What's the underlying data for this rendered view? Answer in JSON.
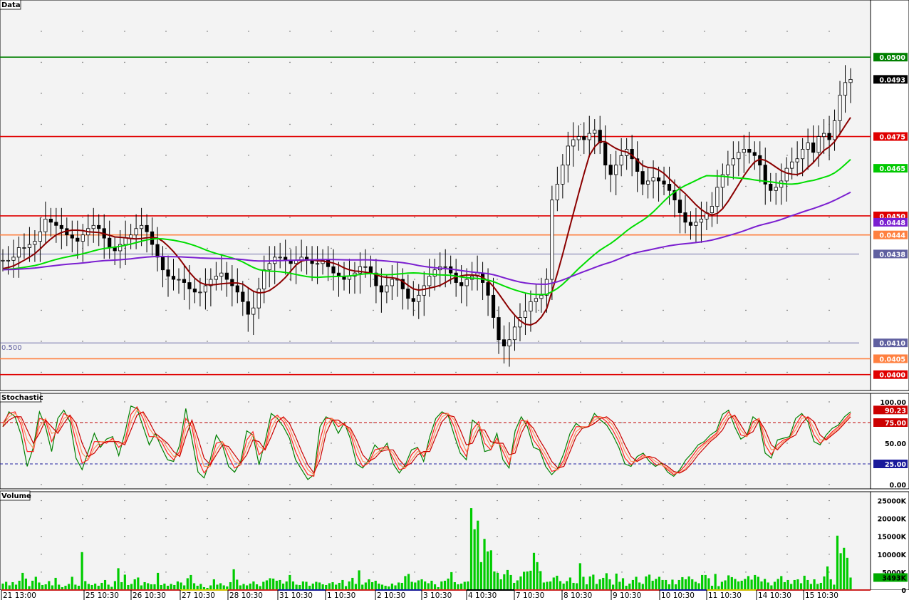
{
  "panels": {
    "price": {
      "title": "Data"
    },
    "stochastic": {
      "title": "Stochastic"
    },
    "volume": {
      "title": "Volume"
    }
  },
  "chart_data": [
    {
      "type": "candlestick",
      "title": "Data",
      "ylim": [
        0.0395,
        0.0518
      ],
      "grid": true,
      "overlay_label": "0.500",
      "horizontal_lines": [
        {
          "value": 0.05,
          "label": "0.0500",
          "color": "#008000"
        },
        {
          "value": 0.0475,
          "label": "0.0475",
          "color": "#e00000"
        },
        {
          "value": 0.045,
          "label": "0.0450",
          "color": "#e00000"
        },
        {
          "value": 0.0444,
          "label": "0.0444",
          "color": "#ff8040"
        },
        {
          "value": 0.0438,
          "label": "0.0438",
          "color": "#6060a0"
        },
        {
          "value": 0.041,
          "label": "0.0410",
          "color": "#6060a0"
        },
        {
          "value": 0.0405,
          "label": "0.0405",
          "color": "#ff8040"
        },
        {
          "value": 0.04,
          "label": "0.0400",
          "color": "#e00000"
        }
      ],
      "price_tags": [
        {
          "value": 0.0493,
          "label": "0.0493",
          "bg": "#000000",
          "fg": "#ffffff"
        },
        {
          "value": 0.0465,
          "label": "0.0465",
          "bg": "#00c800",
          "fg": "#ffffff"
        },
        {
          "value": 0.0448,
          "label": "0.0448",
          "bg": "#7b1fd0",
          "fg": "#ffffff"
        }
      ],
      "x_ticks": [
        "21 13:00",
        "25 10:30",
        "26 10:30",
        "27 10:30",
        "28 10:30",
        "31 10:30",
        "1 10:30",
        "2 10:30",
        "3 10:30",
        "4 10:30",
        "7 10:30",
        "8 10:30",
        "9 10:30",
        "10 10:30",
        "11 10:30",
        "14 10:30",
        "15 10:30"
      ],
      "close_series": [
        0.0436,
        0.0436,
        0.0437,
        0.044,
        0.044,
        0.0441,
        0.0442,
        0.0445,
        0.0449,
        0.0448,
        0.0447,
        0.0446,
        0.0444,
        0.0443,
        0.0442,
        0.0444,
        0.0446,
        0.0447,
        0.0446,
        0.0443,
        0.044,
        0.0439,
        0.0441,
        0.0443,
        0.0444,
        0.0446,
        0.0447,
        0.0445,
        0.0441,
        0.0437,
        0.0433,
        0.0431,
        0.043,
        0.043,
        0.0429,
        0.0427,
        0.0426,
        0.0426,
        0.0428,
        0.043,
        0.0431,
        0.0432,
        0.043,
        0.0428,
        0.0426,
        0.0423,
        0.0419,
        0.0421,
        0.0427,
        0.0433,
        0.0435,
        0.0437,
        0.0437,
        0.0436,
        0.0435,
        0.0436,
        0.0437,
        0.0436,
        0.0435,
        0.0435,
        0.0436,
        0.0434,
        0.0432,
        0.0431,
        0.043,
        0.0431,
        0.0432,
        0.0434,
        0.0434,
        0.0432,
        0.0428,
        0.0426,
        0.0428,
        0.043,
        0.043,
        0.0427,
        0.0424,
        0.0423,
        0.0425,
        0.0428,
        0.0431,
        0.0433,
        0.0434,
        0.0434,
        0.0432,
        0.0429,
        0.0428,
        0.043,
        0.0431,
        0.0432,
        0.0429,
        0.0425,
        0.0418,
        0.0411,
        0.0409,
        0.0411,
        0.0415,
        0.0418,
        0.042,
        0.0423,
        0.0424,
        0.0425,
        0.043,
        0.0455,
        0.046,
        0.0466,
        0.0472,
        0.0474,
        0.0475,
        0.0474,
        0.0476,
        0.0477,
        0.0473,
        0.0466,
        0.0463,
        0.0466,
        0.0469,
        0.0471,
        0.0468,
        0.0464,
        0.046,
        0.0461,
        0.0462,
        0.0461,
        0.046,
        0.0458,
        0.0455,
        0.0451,
        0.0448,
        0.0447,
        0.0448,
        0.0449,
        0.0451,
        0.0453,
        0.0459,
        0.0463,
        0.0466,
        0.0468,
        0.047,
        0.0471,
        0.047,
        0.0469,
        0.0466,
        0.046,
        0.0458,
        0.0459,
        0.0461,
        0.0465,
        0.0467,
        0.0468,
        0.0471,
        0.0473,
        0.047,
        0.0475,
        0.0476,
        0.0474,
        0.048,
        0.0488,
        0.0492,
        0.0493
      ],
      "sma_short_color": "#8b0000",
      "sma_mid_color": "#00dd00",
      "sma_long_color": "#7b1fd0"
    },
    {
      "type": "line",
      "title": "Stochastic",
      "ylim": [
        0,
        100
      ],
      "y_ticks": [
        "100.00",
        "75.00",
        "50.00",
        "25.00",
        "0.00"
      ],
      "levels": [
        {
          "value": 75,
          "label": "75.00",
          "color": "#c00000"
        },
        {
          "value": 25,
          "label": "25.00",
          "color": "#2020a0"
        }
      ],
      "value_tag": {
        "value": 90.23,
        "label": "90.23"
      },
      "series": [
        {
          "color": "#008000",
          "values": [
            70,
            88,
            82,
            60,
            22,
            45,
            88,
            70,
            40,
            80,
            90,
            76,
            32,
            18,
            40,
            62,
            45,
            55,
            58,
            35,
            62,
            95,
            92,
            70,
            48,
            62,
            45,
            30,
            28,
            48,
            92,
            55,
            15,
            8,
            30,
            60,
            48,
            22,
            15,
            28,
            65,
            60,
            24,
            52,
            86,
            80,
            70,
            56,
            30,
            18,
            6,
            12,
            70,
            82,
            78,
            62,
            75,
            55,
            25,
            20,
            30,
            48,
            40,
            50,
            25,
            14,
            24,
            42,
            45,
            28,
            58,
            80,
            88,
            84,
            60,
            38,
            30,
            78,
            72,
            40,
            42,
            62,
            30,
            20,
            65,
            82,
            70,
            45,
            42,
            22,
            12,
            20,
            38,
            62,
            74,
            68,
            70,
            86,
            78,
            72,
            60,
            45,
            25,
            22,
            34,
            38,
            28,
            22,
            26,
            15,
            10,
            18,
            30,
            38,
            48,
            52,
            60,
            65,
            85,
            90,
            70,
            55,
            60,
            82,
            76,
            38,
            32,
            54,
            56,
            58,
            80,
            86,
            76,
            52,
            48,
            60,
            68,
            72,
            82,
            88
          ]
        },
        {
          "color": "#ff2020",
          "values": [
            74,
            86,
            88,
            72,
            40,
            40,
            80,
            78,
            52,
            68,
            86,
            82,
            52,
            26,
            30,
            52,
            52,
            50,
            56,
            45,
            52,
            85,
            94,
            80,
            58,
            58,
            52,
            38,
            30,
            40,
            80,
            70,
            30,
            14,
            24,
            50,
            52,
            34,
            20,
            24,
            54,
            64,
            36,
            44,
            78,
            84,
            76,
            62,
            40,
            24,
            12,
            10,
            54,
            80,
            80,
            70,
            74,
            62,
            36,
            22,
            26,
            42,
            44,
            46,
            32,
            18,
            20,
            36,
            44,
            34,
            50,
            74,
            86,
            86,
            70,
            46,
            34,
            66,
            76,
            50,
            42,
            56,
            40,
            24,
            54,
            78,
            76,
            54,
            44,
            30,
            16,
            18,
            30,
            54,
            70,
            70,
            70,
            82,
            82,
            76,
            66,
            52,
            32,
            24,
            30,
            36,
            32,
            24,
            24,
            18,
            12,
            16,
            24,
            34,
            44,
            50,
            56,
            62,
            78,
            88,
            78,
            60,
            58,
            76,
            80,
            48,
            36,
            48,
            54,
            56,
            72,
            84,
            80,
            60,
            50,
            56,
            64,
            70,
            78,
            86
          ]
        },
        {
          "color": "#ff9060",
          "values": [
            72,
            82,
            86,
            78,
            54,
            44,
            70,
            80,
            62,
            64,
            80,
            84,
            64,
            38,
            30,
            44,
            52,
            52,
            54,
            50,
            50,
            76,
            90,
            86,
            68,
            58,
            56,
            44,
            34,
            36,
            68,
            76,
            44,
            22,
            22,
            42,
            52,
            42,
            28,
            24,
            44,
            60,
            46,
            42,
            68,
            82,
            80,
            68,
            50,
            32,
            18,
            12,
            40,
            72,
            80,
            74,
            72,
            66,
            46,
            28,
            26,
            36,
            42,
            44,
            38,
            24,
            20,
            30,
            40,
            38,
            44,
            66,
            82,
            86,
            78,
            56,
            40,
            56,
            72,
            60,
            46,
            52,
            46,
            30,
            44,
            70,
            78,
            62,
            48,
            36,
            22,
            18,
            26,
            46,
            64,
            70,
            70,
            78,
            82,
            80,
            72,
            58,
            40,
            28,
            28,
            34,
            34,
            28,
            24,
            20,
            14,
            14,
            20,
            30,
            40,
            48,
            54,
            60,
            72,
            84,
            82,
            66,
            58,
            70,
            80,
            58,
            42,
            44,
            52,
            56,
            66,
            80,
            82,
            68,
            54,
            54,
            62,
            68,
            76,
            84
          ]
        },
        {
          "color": "#cc0000",
          "values": [
            70,
            78,
            82,
            82,
            66,
            50,
            62,
            78,
            70,
            62,
            74,
            84,
            74,
            50,
            34,
            38,
            48,
            52,
            52,
            52,
            48,
            66,
            84,
            88,
            76,
            62,
            56,
            50,
            40,
            34,
            58,
            78,
            56,
            32,
            24,
            36,
            48,
            46,
            36,
            26,
            36,
            54,
            52,
            42,
            58,
            76,
            82,
            74,
            58,
            40,
            24,
            14,
            30,
            62,
            78,
            78,
            72,
            68,
            54,
            36,
            28,
            32,
            40,
            42,
            42,
            30,
            22,
            26,
            36,
            40,
            40,
            58,
            76,
            84,
            82,
            66,
            48,
            50,
            66,
            66,
            52,
            50,
            50,
            36,
            38,
            62,
            76,
            68,
            54,
            42,
            28,
            20,
            22,
            40,
            58,
            68,
            70,
            74,
            80,
            82,
            76,
            64,
            48,
            34,
            28,
            32,
            34,
            32,
            26,
            22,
            16,
            14,
            18,
            26,
            36,
            44,
            52,
            58,
            66,
            80,
            84,
            72,
            60,
            64,
            78,
            66,
            48,
            42,
            50,
            56,
            60,
            74,
            82,
            76,
            60,
            54,
            60,
            66,
            74,
            82
          ]
        }
      ]
    },
    {
      "type": "bar",
      "title": "Volume",
      "ylim": [
        0,
        27500
      ],
      "y_ticks": [
        "25000K",
        "20000K",
        "15000K",
        "10000K",
        "5000K",
        "0"
      ],
      "current_label": "3493K",
      "values": [
        1800,
        2300,
        1300,
        2200,
        1500,
        2600,
        4800,
        3200,
        1100,
        2600,
        3700,
        2100,
        1400,
        1600,
        2500,
        1300,
        3400,
        1500,
        800,
        1200,
        1700,
        3700,
        1500,
        1200,
        10600,
        2500,
        1700,
        1400,
        1800,
        1200,
        2000,
        2800,
        1500,
        900,
        2500,
        6100,
        2200,
        4300,
        1400,
        1700,
        3000,
        3500,
        1300,
        2200,
        1900,
        1600,
        1600,
        4800,
        1400,
        1800,
        1200,
        1700,
        1400,
        2400,
        2100,
        1300,
        3300,
        4200,
        1900,
        1200,
        1700,
        800,
        600,
        1300,
        3000,
        1500,
        1900,
        1300,
        1000,
        2200,
        5800,
        2900,
        1300,
        1700,
        1300,
        1800,
        2400,
        1600,
        1100,
        2300,
        2700,
        3300,
        3200,
        2600,
        2800,
        1800,
        2400,
        4200,
        2400,
        1500,
        1400,
        2400,
        2300,
        1200,
        1800,
        2300,
        2100,
        1600,
        1400,
        1900,
        2200,
        1500,
        2000,
        2800,
        1100,
        2400,
        3400,
        1700,
        5500,
        1500,
        2100,
        3000,
        2200,
        2600,
        1800,
        1500,
        1200,
        1000,
        1800,
        1300,
        2100,
        2000,
        3900,
        4500,
        2300,
        2100,
        2700,
        3000,
        2400,
        1900,
        2600,
        1600,
        800,
        2400,
        2600,
        3200,
        5000,
        2200,
        1600,
        1800,
        2300,
        2400,
        22900,
        17000,
        19400,
        7800,
        14300,
        10800,
        11100,
        5200,
        4800,
        3000,
        4400,
        5600,
        4200,
        2000,
        2700,
        3800,
        5100,
        5200,
        5400,
        10400,
        7800,
        5300,
        2100,
        2300,
        2400,
        3500,
        4000,
        2500,
        1800,
        2500,
        3500,
        2000,
        1900,
        7500,
        3700,
        1600,
        3800,
        4300,
        1700,
        3000,
        3400,
        4700,
        3000,
        1500,
        4600,
        2300,
        3300,
        1200,
        1800,
        2800,
        3700,
        2100,
        1700,
        3800,
        4300,
        2600,
        3100,
        3700,
        2800,
        2800,
        1600,
        2900,
        1600,
        2800,
        3600,
        3000,
        3800,
        3000,
        2300,
        1900,
        4200,
        4200,
        3300,
        1200,
        4500,
        1100,
        2300,
        2700,
        4100,
        3600,
        3100,
        2400,
        2600,
        3100,
        3900,
        2900,
        4200,
        3700,
        2400,
        3100,
        2100,
        1300,
        2300,
        3100,
        3900,
        2200,
        2800,
        1700,
        2800,
        3000,
        1900,
        4000,
        2800,
        1700,
        3000,
        1700,
        2000,
        3800,
        6600,
        3000,
        1500,
        15200,
        10300,
        11800,
        9000,
        3493
      ]
    }
  ]
}
